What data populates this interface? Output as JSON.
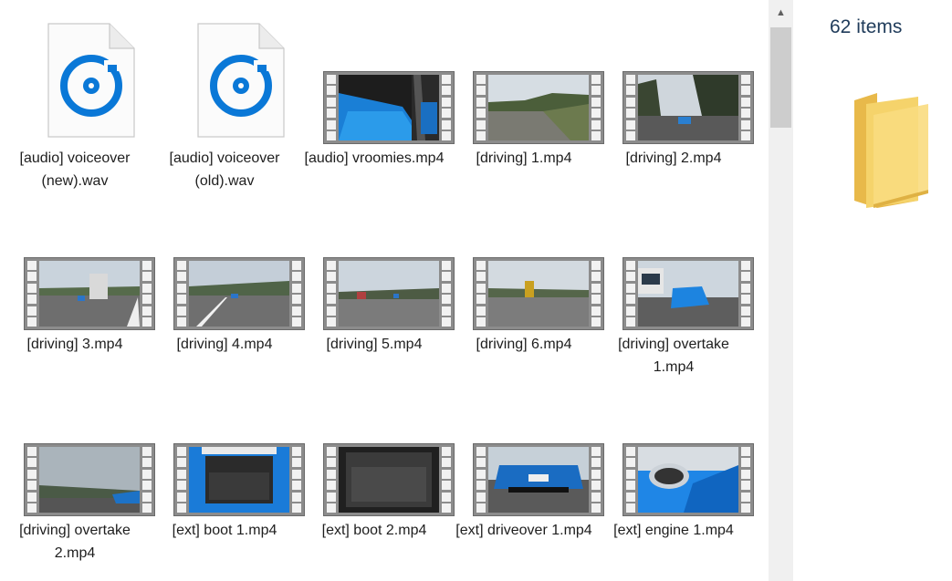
{
  "files": [
    {
      "name": "[audio] voiceover (new).wav",
      "kind": "audio",
      "scene": "doc"
    },
    {
      "name": "[audio] voiceover (old).wav",
      "kind": "audio",
      "scene": "doc"
    },
    {
      "name": "[audio] vroomies.mp4",
      "kind": "video",
      "scene": "car-interior"
    },
    {
      "name": "[driving] 1.mp4",
      "kind": "video",
      "scene": "road-hill"
    },
    {
      "name": "[driving] 2.mp4",
      "kind": "video",
      "scene": "road-trees"
    },
    {
      "name": "[driving] 3.mp4",
      "kind": "video",
      "scene": "road-truck"
    },
    {
      "name": "[driving] 4.mp4",
      "kind": "video",
      "scene": "road-lane"
    },
    {
      "name": "[driving] 5.mp4",
      "kind": "video",
      "scene": "road-town"
    },
    {
      "name": "[driving] 6.mp4",
      "kind": "video",
      "scene": "road-plain"
    },
    {
      "name": "[driving] overtake 1.mp4",
      "kind": "video",
      "scene": "road-car"
    },
    {
      "name": "[driving] overtake 2.mp4",
      "kind": "video",
      "scene": "road-cloudy"
    },
    {
      "name": "[ext] boot 1.mp4",
      "kind": "video",
      "scene": "boot-blue"
    },
    {
      "name": "[ext] boot 2.mp4",
      "kind": "video",
      "scene": "boot-dark"
    },
    {
      "name": "[ext] driveover 1.mp4",
      "kind": "video",
      "scene": "car-front"
    },
    {
      "name": "[ext] engine 1.mp4",
      "kind": "video",
      "scene": "car-badge"
    }
  ],
  "details": {
    "item_count": "62 items",
    "icon": "folder-icon"
  },
  "scrollbar": {
    "up_icon": "chevron-up-icon"
  },
  "colors": {
    "audio_icon": "#0a78d7",
    "folder": "#f5d36b",
    "count_text": "#1f3b5a"
  }
}
